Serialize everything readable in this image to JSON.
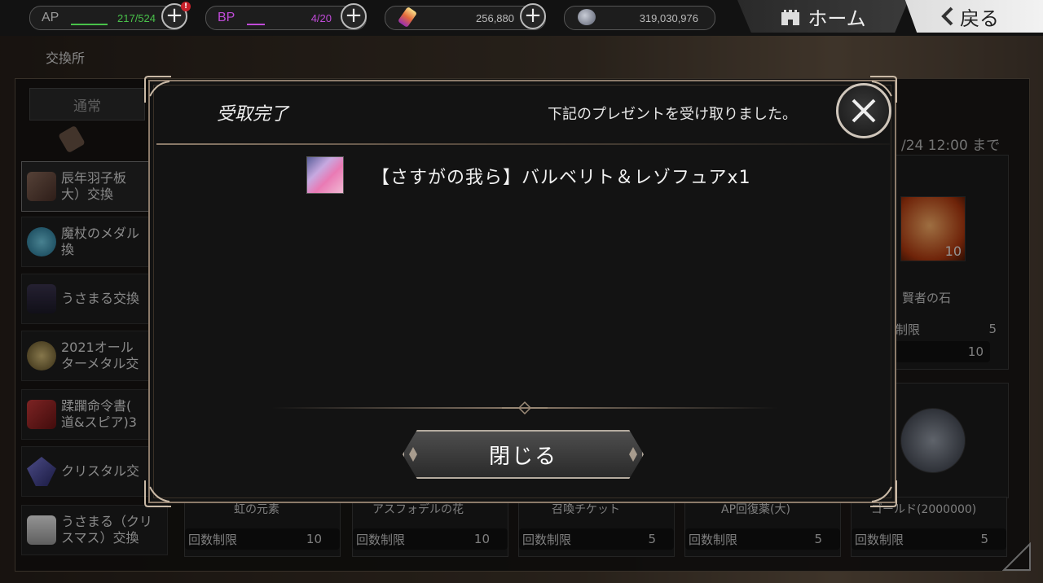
{
  "topbar": {
    "ap": {
      "label": "AP",
      "value": "217/524",
      "color": "#49c24a",
      "fill_fraction": 0.41
    },
    "bp": {
      "label": "BP",
      "value": "4/20",
      "color": "#c04bd8",
      "fill_fraction": 0.2
    },
    "gems": {
      "value": "256,880",
      "icon": "gem-icon"
    },
    "gold": {
      "value": "319,030,976",
      "icon": "coin-icon"
    },
    "plus_symbol": "+",
    "alert_symbol": "!",
    "home_label": "ホーム",
    "back_label": "戻る"
  },
  "page": {
    "title": "交換所",
    "tab_normal": "通常",
    "period": "/24 12:00 まで"
  },
  "sidebar": {
    "items": [
      {
        "label": "辰年羽子板\n大）交換",
        "icon": "paddle-icon"
      },
      {
        "label": "魔杖のメダル\n換",
        "icon": "medal-icon"
      },
      {
        "label": "うさまる交換",
        "icon": "usamaru-icon"
      },
      {
        "label": "2021オール\nターメタル交",
        "icon": "star-medal-icon"
      },
      {
        "label": "蹂躙命令書(\n道&スピア)3",
        "icon": "order-book-icon"
      },
      {
        "label": "クリスタル交",
        "icon": "crystal-icon"
      },
      {
        "label": "うさまる（クリ\nスマス）交換",
        "icon": "usamaru-xmas-icon"
      }
    ]
  },
  "cards": {
    "sage_stone": {
      "name": "賢者の石",
      "count": "10",
      "limit_label": "回数制限",
      "limit": "5",
      "stock": "10"
    },
    "bottom": [
      {
        "name": "虹の元素",
        "limit_label": "回数制限",
        "limit": "10"
      },
      {
        "name": "アスフォデルの花",
        "limit_label": "回数制限",
        "limit": "10"
      },
      {
        "name": "召喚チケット",
        "limit_label": "回数制限",
        "limit": "5"
      },
      {
        "name": "AP回復薬(大)",
        "limit_label": "回数制限",
        "limit": "5"
      },
      {
        "name": "ゴールド(2000000)",
        "limit_label": "回数制限",
        "limit": "5"
      }
    ]
  },
  "modal": {
    "title": "受取完了",
    "message": "下記のプレゼントを受け取りました。",
    "reward": "【さすがの我ら】バルベリト＆レゾフュアx1",
    "close_button": "閉じる"
  }
}
